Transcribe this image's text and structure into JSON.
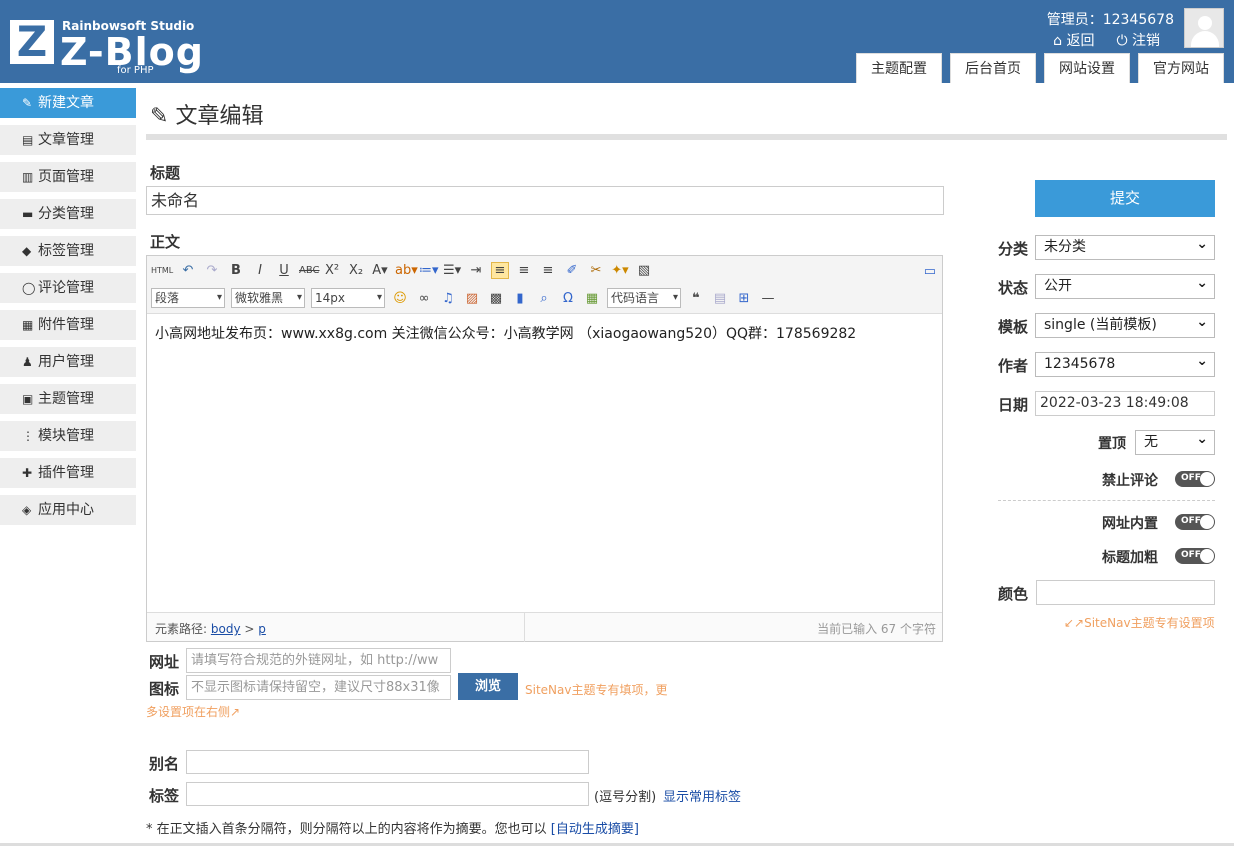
{
  "header": {
    "logo_letter": "Z",
    "logo_studio": "Rainbowsoft Studio",
    "logo_name": "Z-Blog",
    "logo_php": "for PHP",
    "admin": "管理员：12345678",
    "back": "⌂ 返回",
    "logout": "⏻ 注销",
    "nav": [
      "主题配置",
      "后台首页",
      "网站设置",
      "官方网站"
    ]
  },
  "sidebar": {
    "items": [
      {
        "icon": "✎",
        "label": "新建文章"
      },
      {
        "icon": "▤",
        "label": "文章管理"
      },
      {
        "icon": "▥",
        "label": "页面管理"
      },
      {
        "icon": "▬",
        "label": "分类管理"
      },
      {
        "icon": "◆",
        "label": "标签管理"
      },
      {
        "icon": "◯",
        "label": "评论管理"
      },
      {
        "icon": "▦",
        "label": "附件管理"
      },
      {
        "icon": "♟",
        "label": "用户管理"
      },
      {
        "icon": "▣",
        "label": "主题管理"
      },
      {
        "icon": "⋮",
        "label": "模块管理"
      },
      {
        "icon": "✚",
        "label": "插件管理"
      },
      {
        "icon": "◈",
        "label": "应用中心"
      }
    ]
  },
  "main": {
    "title": "文章编辑",
    "title_label": "标题",
    "title_value": "未命名",
    "body_label": "正文",
    "toolbar": {
      "para": "段落",
      "font": "微软雅黑",
      "size": "14px",
      "code": "代码语言"
    },
    "content": "小高网地址发布页：www.xx8g.com 关注微信公众号：小高教学网 （xiaogaowang520）QQ群：178569282",
    "status_path_label": "元素路径:",
    "status_body": "body",
    "status_gt": ">",
    "status_p": "p",
    "status_count": "当前已输入 67 个字符",
    "url_label": "网址",
    "url_placeholder": "请填写符合规范的外链网址，如 http://ww",
    "icon_label": "图标",
    "icon_placeholder": "不显示图标请保持留空，建议尺寸88x31像",
    "browse": "浏览",
    "hint_line1": "SiteNav主题专有填项，更",
    "hint_line2": "多设置项在右侧↗",
    "alias_label": "别名",
    "tag_label": "标签",
    "tag_hint": "(逗号分割)",
    "tag_link": "显示常用标签",
    "note_text": "* 在正文插入首条分隔符，则分隔符以上的内容将作为摘要。您也可以 ",
    "note_link": "[自动生成摘要]"
  },
  "side": {
    "submit": "提交",
    "category_label": "分类",
    "category": "未分类",
    "status_label": "状态",
    "status": "公开",
    "template_label": "模板",
    "template": "single (当前模板)",
    "author_label": "作者",
    "author": "12345678",
    "date_label": "日期",
    "date": "2022-03-23 18:49:08",
    "top_label": "置顶",
    "top": "无",
    "no_comment_label": "禁止评论",
    "url_inner_label": "网址内置",
    "bold_title_label": "标题加粗",
    "toggle_text": "OFF",
    "color_label": "颜色",
    "sitenav_hint": "↙↗SiteNav主题专有设置项"
  }
}
